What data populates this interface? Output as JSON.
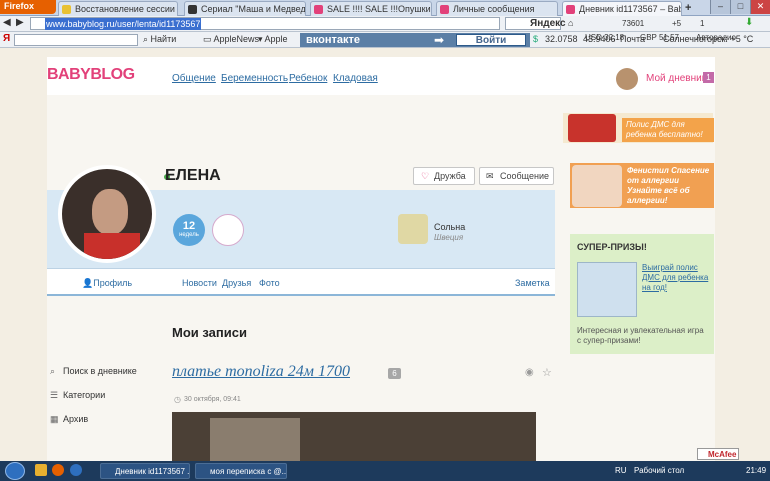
{
  "browser": {
    "app_button": "Firefox",
    "tabs": [
      {
        "label": "Восстановление сессии",
        "color": "#e8c133"
      },
      {
        "label": "Сериал \"Маша и Медведь\" ...",
        "color": "#333333"
      },
      {
        "label": "SALE !!!! SALE !!!Опушки из п...",
        "color": "#e2417a"
      },
      {
        "label": "Личные сообщения",
        "color": "#e2417a"
      },
      {
        "label": "Дневник id1173567 – BabyBl...",
        "color": "#e2417a"
      }
    ],
    "new_tab": "+",
    "url": "www.babyblog.ru/user/lenta/id1173567",
    "search_engine": "Яндекс",
    "toolbar_find": "Найти",
    "bookmarks": [
      "AppleNews",
      "Apple"
    ],
    "vk_label": "вконтакте",
    "vk_login": "Войти",
    "top_right": {
      "counter": "73601",
      "plus": "+5",
      "count": "1"
    },
    "rates": {
      "usd": "USD 32,18",
      "gbp": "GBP 51,57",
      "autoradio": "Авторадио"
    },
    "stocks": {
      "a": "32.0758",
      "b": "43.9406"
    },
    "mail": "Почта",
    "weather": "Солнечногорск: +5 °C"
  },
  "site": {
    "logo": "BABYBLOG",
    "nav": [
      "Общение",
      "Беременность",
      "Ребенок",
      "Кладовая"
    ],
    "my_diary": "Мой дневник",
    "my_diary_count": "1",
    "gifts_banner": "Полис ДМС для ребенка бесплатно!"
  },
  "profile": {
    "name": "ЕЛЕНА",
    "friend_button": "Дружба",
    "message_button": "Сообщение",
    "age": "12",
    "age_unit": "недель",
    "city": "Сольна",
    "country": "Швеция",
    "profile_link": "Профиль",
    "subnav": [
      "Новости",
      "Друзья",
      "Фото"
    ],
    "note_link": "Заметка"
  },
  "ads": {
    "fenistil": "Фенистил Спасение от аллергии Узнайте всё об аллергии!",
    "prize_title": "СУПЕР-ПРИЗЫ!",
    "prize_link": "Выиграй полис ДМС для ребенка на год!",
    "prize_desc": "Интересная и увлекательная игра с супер-призами!"
  },
  "diary": {
    "section_title": "Мои записи",
    "sidebar": [
      {
        "label": "Поиск в дневнике",
        "icon": "search-icon"
      },
      {
        "label": "Категории",
        "icon": "list-icon"
      },
      {
        "label": "Архив",
        "icon": "calendar-icon"
      }
    ],
    "post_title": "платье monoliza 24м 1700",
    "post_comments": "6",
    "post_date": "30 октября, 09:41"
  },
  "taskbar": {
    "items": [
      "Дневник id1173567 ...",
      "моя переписка с @..."
    ],
    "lang": "RU",
    "desktop": "Рабочий стол",
    "time": "21:49",
    "mcafee": "McAfee"
  }
}
